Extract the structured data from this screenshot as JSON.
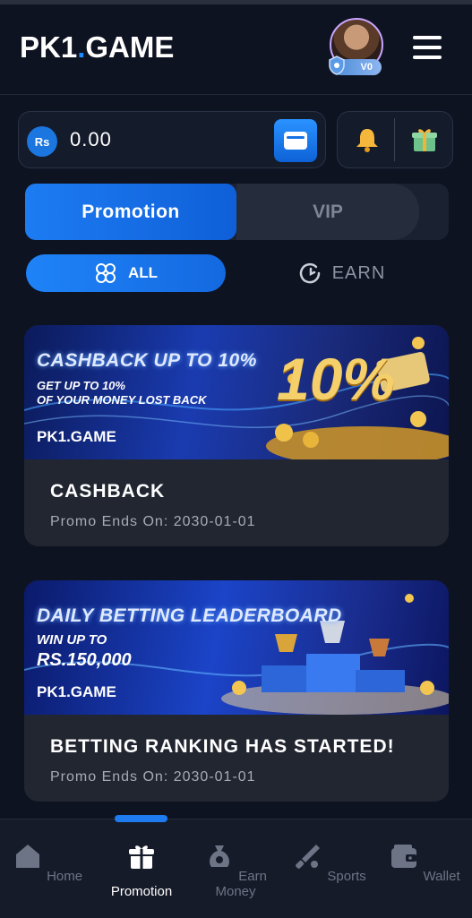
{
  "header": {
    "logo_left": "PK1",
    "logo_dot": ".",
    "logo_right": "GAME",
    "vip_level": "V0"
  },
  "balance": {
    "currency": "Rs",
    "amount": "0.00"
  },
  "tabs": [
    {
      "label": "Promotion",
      "active": true
    },
    {
      "label": "VIP",
      "active": false
    }
  ],
  "filters": [
    {
      "label": "ALL",
      "active": true
    },
    {
      "label": "EARN",
      "active": false
    }
  ],
  "promos": [
    {
      "banner_heading": "CASHBACK UP TO 10%",
      "banner_sub1": "GET UP TO 10%",
      "banner_sub2": "OF YOUR MONEY LOST BACK",
      "banner_big": "10%",
      "banner_logo": "PK1.GAME",
      "title": "CASHBACK",
      "ends": "Promo Ends On: 2030-01-01"
    },
    {
      "banner_heading": "DAILY BETTING LEADERBOARD",
      "banner_sub1": "WIN UP TO",
      "banner_sub2": "RS.150,000",
      "banner_logo": "PK1.GAME",
      "title": "BETTING RANKING HAS STARTED!",
      "ends": "Promo Ends On: 2030-01-01"
    }
  ],
  "nav": [
    {
      "label": "Home",
      "icon": "home-icon",
      "active": false
    },
    {
      "label": "Promotion",
      "icon": "gift-icon",
      "active": true
    },
    {
      "label": "Earn Money",
      "icon": "money-bag-icon",
      "active": false
    },
    {
      "label": "Sports",
      "icon": "cricket-icon",
      "active": false
    },
    {
      "label": "Wallet",
      "icon": "wallet-icon",
      "active": false
    }
  ],
  "colors": {
    "background": "#0e1322",
    "accent": "#1e7bf0",
    "card": "#222631"
  }
}
